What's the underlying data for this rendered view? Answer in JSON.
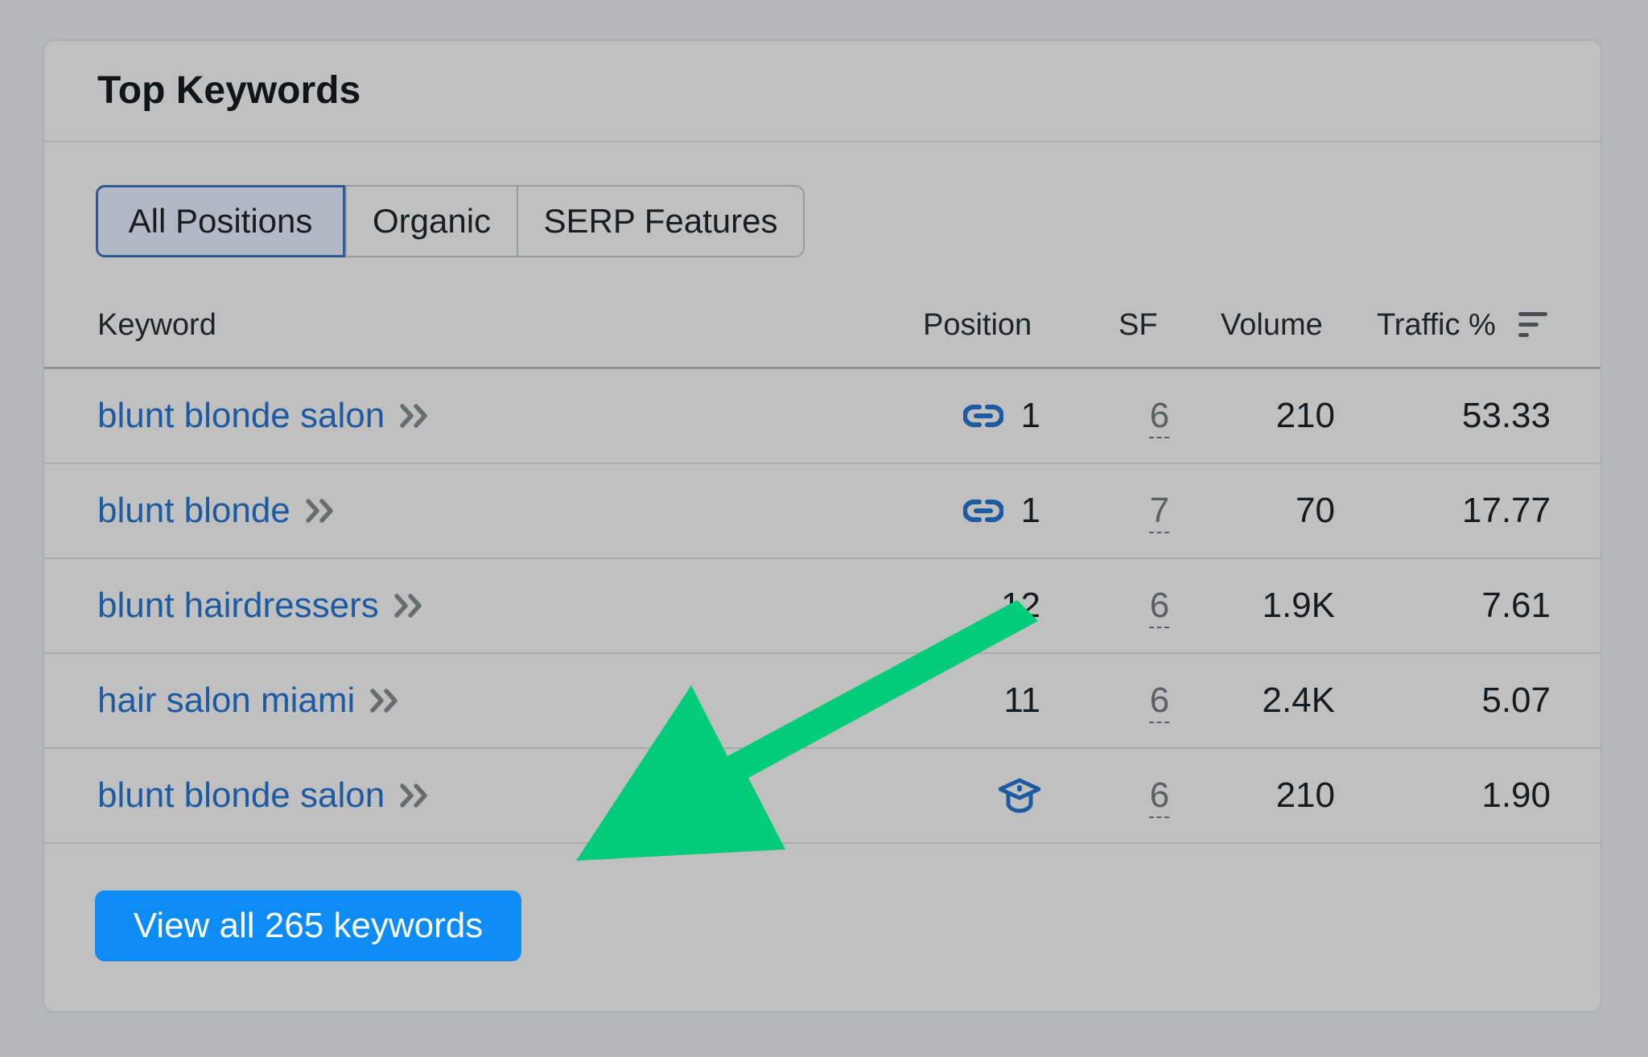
{
  "card": {
    "title": "Top Keywords"
  },
  "tabs": [
    {
      "label": "All Positions",
      "active": true
    },
    {
      "label": "Organic",
      "active": false
    },
    {
      "label": "SERP Features",
      "active": false
    }
  ],
  "table": {
    "columns": {
      "keyword": "Keyword",
      "position": "Position",
      "sf": "SF",
      "volume": "Volume",
      "traffic": "Traffic %"
    },
    "rows": [
      {
        "keyword": "blunt blonde salon",
        "position_icon": "link-icon",
        "position": "1",
        "sf": "6",
        "volume": "210",
        "traffic": "53.33"
      },
      {
        "keyword": "blunt blonde",
        "position_icon": "link-icon",
        "position": "1",
        "sf": "7",
        "volume": "70",
        "traffic": "17.77"
      },
      {
        "keyword": "blunt hairdressers",
        "position_icon": "",
        "position": "12",
        "sf": "6",
        "volume": "1.9K",
        "traffic": "7.61"
      },
      {
        "keyword": "hair salon miami",
        "position_icon": "",
        "position": "11",
        "sf": "6",
        "volume": "2.4K",
        "traffic": "5.07"
      },
      {
        "keyword": "blunt blonde salon",
        "position_icon": "graduation-cap-icon",
        "position": "",
        "sf": "6",
        "volume": "210",
        "traffic": "1.90"
      }
    ]
  },
  "button": {
    "label": "View all 265 keywords"
  },
  "colors": {
    "background": "#b6b7ba",
    "card": "#c0c0c0",
    "link": "#1c5aa1",
    "primary_button": "#0d8cf5",
    "annotation_arrow": "#00cc7a"
  }
}
